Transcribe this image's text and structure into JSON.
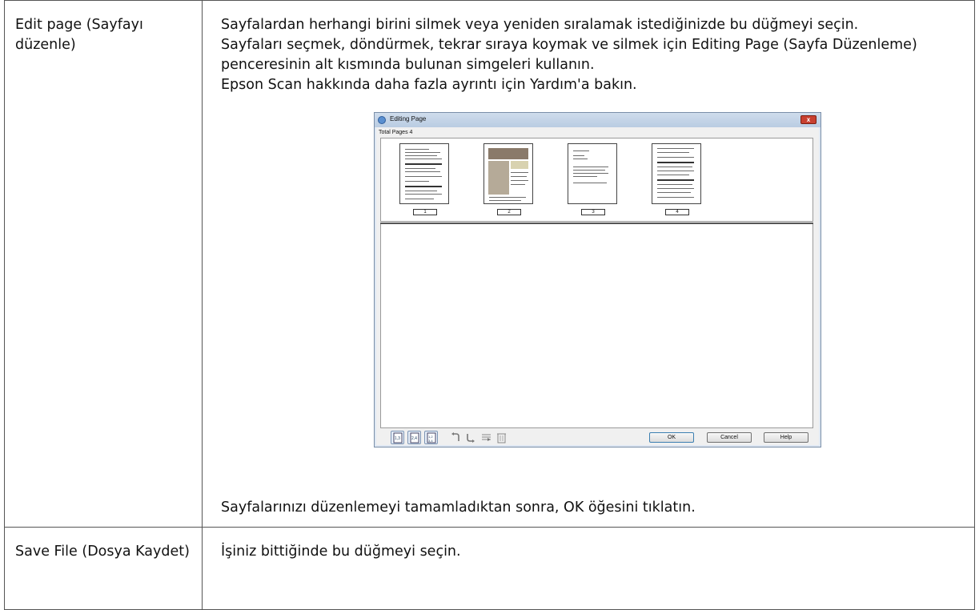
{
  "rows": [
    {
      "name": "Edit page (Sayfayı düzenle)",
      "paragraphs": [
        "Sayfalardan herhangi birini silmek veya yeniden sıralamak istediğinizde bu düğmeyi seçin.",
        "Sayfaları seçmek, döndürmek, tekrar sıraya koymak ve silmek için Editing Page (Sayfa Düzenleme) penceresinin alt kısmında bulunan simgeleri kullanın.",
        "Epson Scan hakkında daha fazla ayrıntı için Yardım'a bakın."
      ],
      "footer": "Sayfalarınızı düzenlemeyi tamamladıktan sonra, OK öğesini tıklatın."
    },
    {
      "name": "Save File (Dosya Kaydet)",
      "paragraphs": [
        "İşiniz bittiğinde bu düğmeyi seçin."
      ]
    }
  ],
  "dialog": {
    "title": "Editing Page",
    "close": "x",
    "total_pages": "Total Pages 4",
    "pages": [
      "1",
      "2",
      "3",
      "4"
    ],
    "buttons": {
      "ok": "OK",
      "cancel": "Cancel",
      "help": "Help"
    },
    "toolbar_icons": [
      "odd-pages-icon",
      "even-pages-icon",
      "all-pages-icon",
      "rotate-left-icon",
      "rotate-right-icon",
      "reorder-icon",
      "delete-icon"
    ],
    "accent": "#5a8fd0",
    "close_color": "#c84030"
  }
}
